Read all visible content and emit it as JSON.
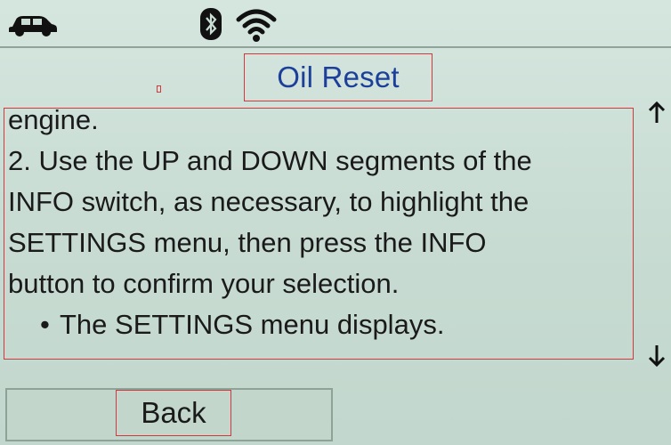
{
  "status_bar": {
    "icons": [
      "car-icon",
      "bluetooth-icon",
      "wifi-icon"
    ]
  },
  "header": {
    "title": "Oil Reset"
  },
  "content": {
    "lines": [
      "engine.",
      "2. Use the UP and DOWN segments of the",
      "INFO switch, as necessary, to highlight the",
      "SETTINGS menu, then press the INFO",
      "button to confirm your selection."
    ],
    "bullet_symbol": "•",
    "bullet_text": "The SETTINGS menu displays."
  },
  "scroll": {
    "up_icon": "arrow-up-icon",
    "down_icon": "arrow-down-icon",
    "up_glyph": "↑",
    "down_glyph": "↓"
  },
  "footer": {
    "back_label": "Back"
  },
  "colors": {
    "background": "#c9ddd4",
    "title": "#1c3f9a",
    "text": "#1a1a1a",
    "highlight_box": "#d0393d"
  }
}
